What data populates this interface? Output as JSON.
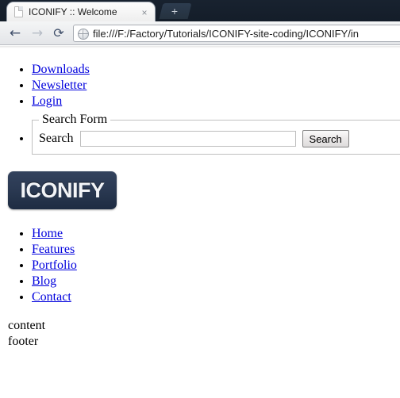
{
  "browser": {
    "tab": {
      "title": "ICONIFY :: Welcome",
      "favicon": "document-icon",
      "close_label": "×"
    },
    "new_tab_label": "+",
    "toolbar": {
      "back_label": "←",
      "forward_label": "→",
      "reload_label": "⟳",
      "site_icon": "globe-icon",
      "url": "file:///F:/Factory/Tutorials/ICONIFY-site-coding/ICONIFY/in"
    }
  },
  "page": {
    "top_links": [
      {
        "label": "Downloads"
      },
      {
        "label": "Newsletter"
      },
      {
        "label": "Login"
      }
    ],
    "search_form": {
      "legend": "Search Form",
      "label": "Search",
      "input_value": "",
      "input_placeholder": "",
      "submit_label": "Search"
    },
    "logo": {
      "text": "ICONIFY",
      "bg_color": "#2b3a53",
      "text_color": "#f2f4f7"
    },
    "nav_links": [
      {
        "label": "Home"
      },
      {
        "label": "Features"
      },
      {
        "label": "Portfolio"
      },
      {
        "label": "Blog"
      },
      {
        "label": "Contact"
      }
    ],
    "content_text": "content",
    "footer_text": "footer"
  },
  "colors": {
    "tabbar_bg": "#16202e",
    "link": "#0000dd",
    "toolbar_bg": "#e9ebee"
  }
}
